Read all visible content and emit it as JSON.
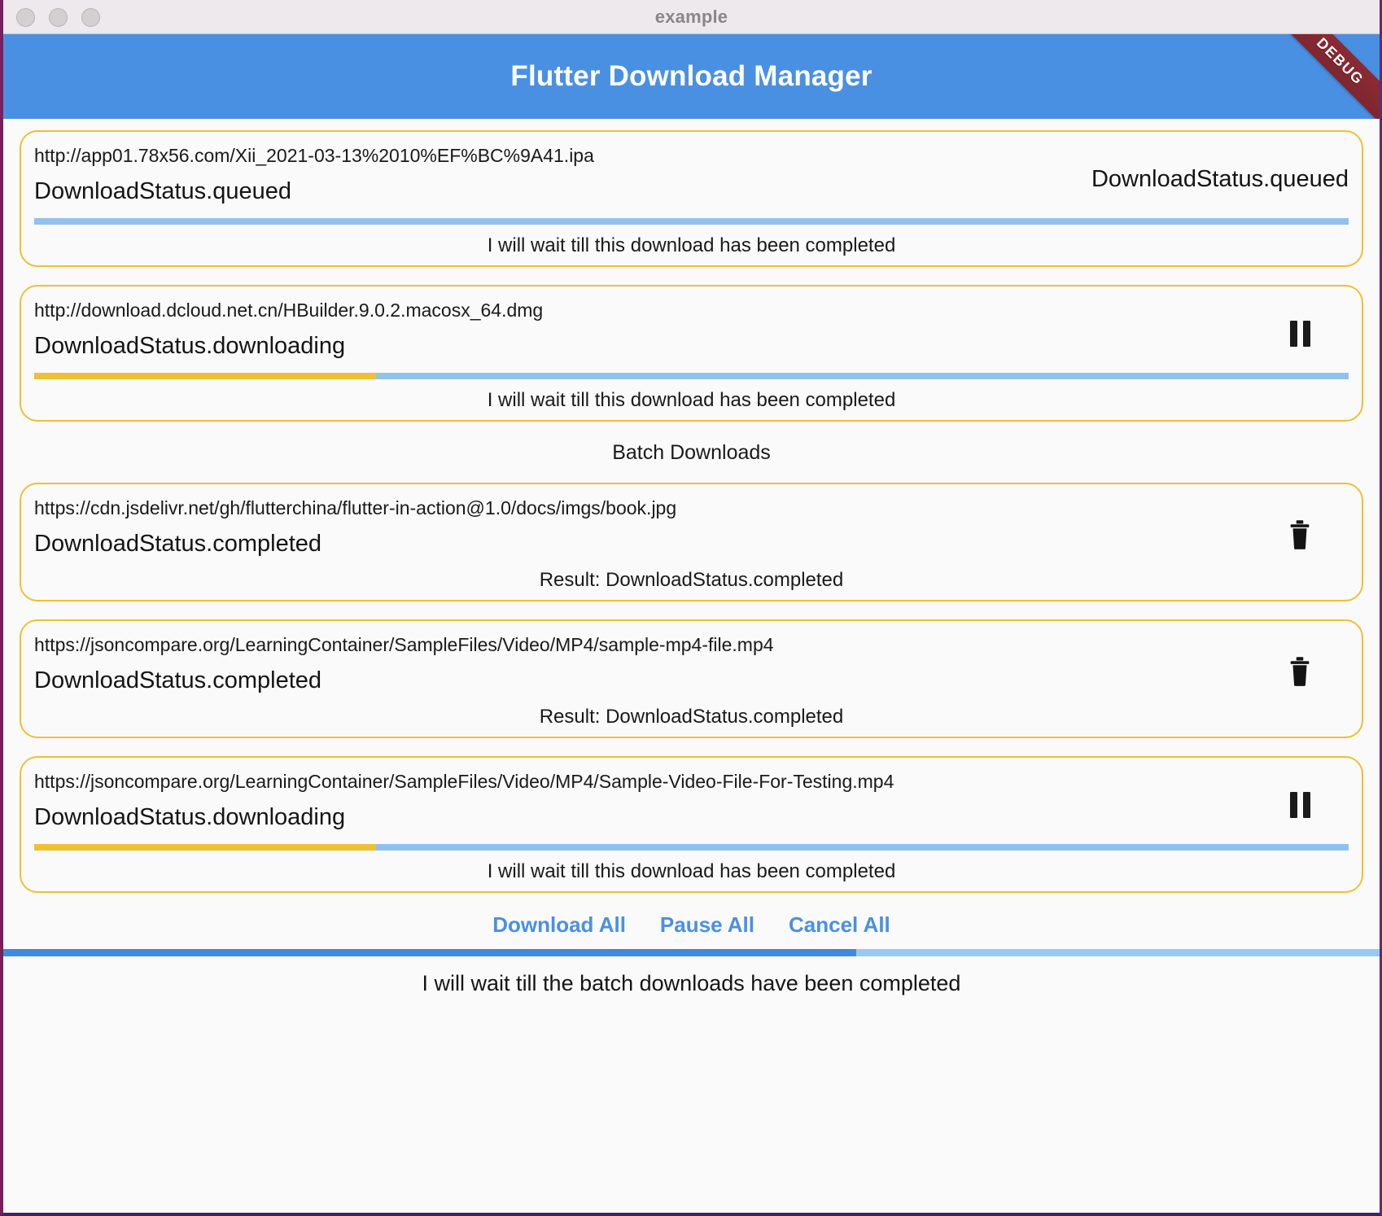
{
  "window": {
    "title": "example",
    "traffic_lights": [
      "close",
      "minimize",
      "zoom"
    ]
  },
  "appbar": {
    "title": "Flutter Download Manager",
    "debug_banner": "DEBUG",
    "bg_color": "#4a90e2",
    "banner_color": "#8d2a33"
  },
  "colors": {
    "card_border": "#efc034",
    "progress_track": "#90c2ee",
    "progress_fill": "#efc034",
    "batch_track": "#9bc8f0",
    "batch_fill": "#3f8ae0",
    "link": "#4a90e2"
  },
  "single_downloads": [
    {
      "url": "http://app01.78x56.com/Xii_2021-03-13%2010%EF%BC%9A41.ipa",
      "status": "DownloadStatus.queued",
      "trailing_kind": "status-text",
      "trailing_text": "DownloadStatus.queued",
      "progress_percent": 0,
      "progress_visible": true,
      "hint": "I will wait till this download has been completed"
    },
    {
      "url": "http://download.dcloud.net.cn/HBuilder.9.0.2.macosx_64.dmg",
      "status": "DownloadStatus.downloading",
      "trailing_kind": "pause-icon",
      "trailing_text": "",
      "progress_percent": 26,
      "progress_visible": true,
      "hint": "I will wait till this download has been completed"
    }
  ],
  "batch": {
    "section_title": "Batch Downloads",
    "items": [
      {
        "url": "https://cdn.jsdelivr.net/gh/flutterchina/flutter-in-action@1.0/docs/imgs/book.jpg",
        "status": "DownloadStatus.completed",
        "trailing_kind": "trash-icon",
        "trailing_text": "",
        "progress_percent": 100,
        "progress_visible": false,
        "hint": "Result: DownloadStatus.completed"
      },
      {
        "url": "https://jsoncompare.org/LearningContainer/SampleFiles/Video/MP4/sample-mp4-file.mp4",
        "status": "DownloadStatus.completed",
        "trailing_kind": "trash-icon",
        "trailing_text": "",
        "progress_percent": 100,
        "progress_visible": false,
        "hint": "Result: DownloadStatus.completed"
      },
      {
        "url": "https://jsoncompare.org/LearningContainer/SampleFiles/Video/MP4/Sample-Video-File-For-Testing.mp4",
        "status": "DownloadStatus.downloading",
        "trailing_kind": "pause-icon",
        "trailing_text": "",
        "progress_percent": 26,
        "progress_visible": true,
        "hint": "I will wait till this download has been completed"
      }
    ],
    "actions": [
      {
        "label": "Download All",
        "name": "download-all-button"
      },
      {
        "label": "Pause All",
        "name": "pause-all-button"
      },
      {
        "label": "Cancel All",
        "name": "cancel-all-button"
      }
    ],
    "overall_progress_percent": 62,
    "overall_hint": "I will wait till the batch downloads have been completed"
  }
}
